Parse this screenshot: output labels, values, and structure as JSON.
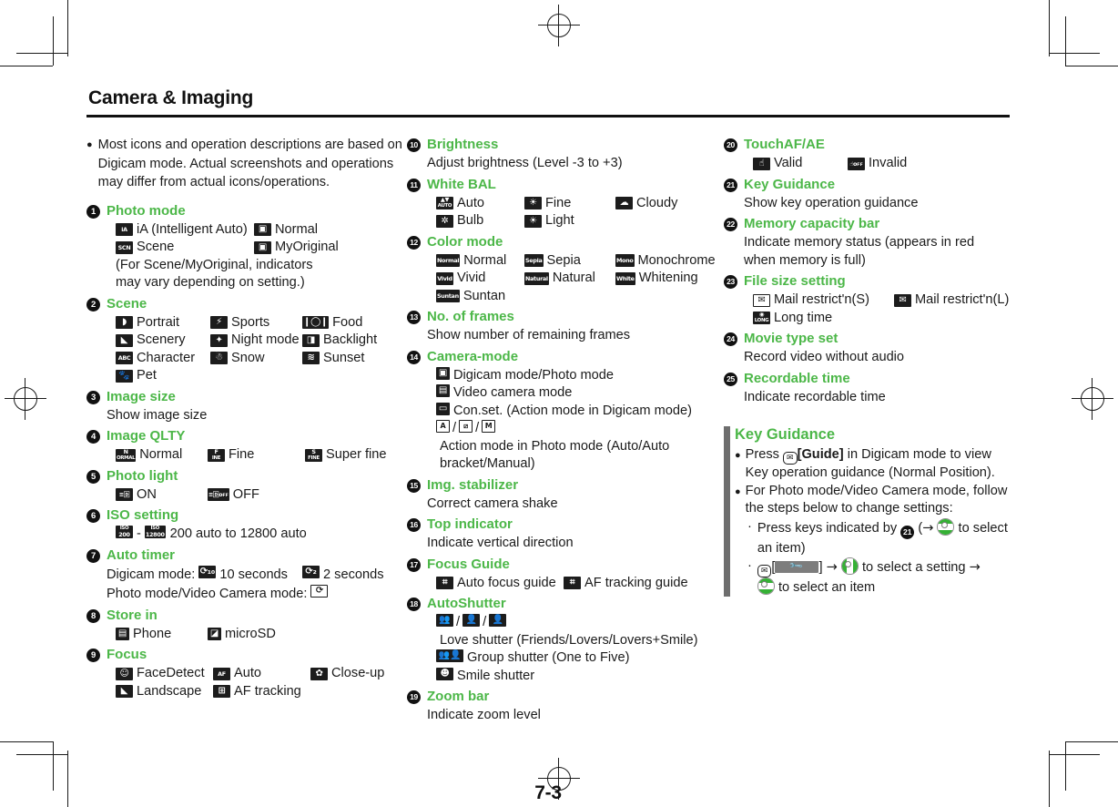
{
  "document": {
    "chapter_title": "Camera & Imaging",
    "page_number": "7-3"
  },
  "intro_note": "Most icons and operation descriptions are based on Digicam mode. Actual screenshots and operations may differ from actual icons/operations.",
  "column1": {
    "entries": [
      {
        "num": "1",
        "title": "Photo mode",
        "rows": [
          [
            {
              "icon": "iA",
              "label": "iA (Intelligent Auto)"
            },
            {
              "icon": "camera",
              "label": "Normal"
            }
          ],
          [
            {
              "icon": "SCN",
              "label": "Scene"
            },
            {
              "icon": "my-camera",
              "label": "MyOriginal"
            }
          ]
        ],
        "note": "(For Scene/MyOriginal, indicators may vary depending on setting.)"
      },
      {
        "num": "2",
        "title": "Scene",
        "rows": [
          [
            {
              "icon": "portrait",
              "label": "Portrait"
            },
            {
              "icon": "sports",
              "label": "Sports"
            },
            {
              "icon": "food",
              "label": "Food"
            }
          ],
          [
            {
              "icon": "scenery",
              "label": "Scenery"
            },
            {
              "icon": "night",
              "label": "Night mode"
            },
            {
              "icon": "backlight",
              "label": "Backlight"
            }
          ],
          [
            {
              "icon": "ABC",
              "label": "Character"
            },
            {
              "icon": "snow",
              "label": "Snow"
            },
            {
              "icon": "sunset",
              "label": "Sunset"
            }
          ],
          [
            {
              "icon": "pet",
              "label": "Pet"
            }
          ]
        ]
      },
      {
        "num": "3",
        "title": "Image size",
        "desc": "Show image size"
      },
      {
        "num": "4",
        "title": "Image QLTY",
        "rows": [
          [
            {
              "icon": "N-ORMAL",
              "label": "Normal"
            },
            {
              "icon": "F-INE",
              "label": "Fine"
            },
            {
              "icon": "S-FINE",
              "label": "Super fine"
            }
          ]
        ]
      },
      {
        "num": "5",
        "title": "Photo light",
        "rows": [
          [
            {
              "icon": "light-on",
              "label": "ON"
            },
            {
              "icon": "light-off",
              "label": "OFF"
            }
          ]
        ]
      },
      {
        "num": "6",
        "title": "ISO setting",
        "iso_line": {
          "icon_low": "ISO 200",
          "dash": "-",
          "icon_high": "ISO 12800",
          "label": "200 auto to 12800 auto"
        }
      },
      {
        "num": "7",
        "title": "Auto timer",
        "timer_line1_prefix": "Digicam mode:",
        "timer_10": "10 seconds",
        "timer_2": "2 seconds",
        "timer_line2_prefix": "Photo mode/Video Camera mode:"
      },
      {
        "num": "8",
        "title": "Store in",
        "rows": [
          [
            {
              "icon": "phone",
              "label": "Phone"
            },
            {
              "icon": "microsd",
              "label": "microSD"
            }
          ]
        ]
      },
      {
        "num": "9",
        "title": "Focus",
        "rows": [
          [
            {
              "icon": "facedetect",
              "label": "FaceDetect"
            },
            {
              "icon": "AF",
              "label": "Auto"
            },
            {
              "icon": "closeup",
              "label": "Close-up"
            }
          ],
          [
            {
              "icon": "landscape",
              "label": "Landscape"
            },
            {
              "icon": "af-tracking",
              "label": "AF tracking"
            }
          ]
        ]
      }
    ]
  },
  "column2": {
    "entries": [
      {
        "num": "10",
        "title": "Brightness",
        "desc": "Adjust brightness (Level -3 to +3)"
      },
      {
        "num": "11",
        "title": "White BAL",
        "rows": [
          [
            {
              "icon": "wb-auto",
              "label": "Auto"
            },
            {
              "icon": "wb-fine",
              "label": "Fine"
            },
            {
              "icon": "wb-cloudy",
              "label": "Cloudy"
            }
          ],
          [
            {
              "icon": "wb-bulb",
              "label": "Bulb"
            },
            {
              "icon": "wb-light",
              "label": "Light"
            }
          ]
        ]
      },
      {
        "num": "12",
        "title": "Color mode",
        "rows": [
          [
            {
              "icon": "Normal",
              "label": "Normal"
            },
            {
              "icon": "Sepia",
              "label": "Sepia"
            },
            {
              "icon": "Mono",
              "label": "Monochrome"
            }
          ],
          [
            {
              "icon": "Vivid",
              "label": "Vivid"
            },
            {
              "icon": "Natural",
              "label": "Natural"
            },
            {
              "icon": "White",
              "label": "Whitening"
            }
          ],
          [
            {
              "icon": "Suntan",
              "label": "Suntan"
            }
          ]
        ]
      },
      {
        "num": "13",
        "title": "No. of frames",
        "desc": "Show number of remaining frames"
      },
      {
        "num": "14",
        "title": "Camera-mode",
        "mode_lines": [
          {
            "icons": [
              "cam-digicam"
            ],
            "label": "Digicam mode/Photo mode"
          },
          {
            "icons": [
              "cam-video"
            ],
            "label": "Video camera mode"
          },
          {
            "icons": [
              "cam-conset"
            ],
            "label": "Con.set. (Action mode in Digicam mode)"
          },
          {
            "icons": [
              "act-A",
              "act-bracket",
              "act-M"
            ],
            "label": "Action mode in Photo mode (Auto/Auto bracket/Manual)"
          }
        ]
      },
      {
        "num": "15",
        "title": "Img. stabilizer",
        "desc": "Correct camera shake"
      },
      {
        "num": "16",
        "title": "Top indicator",
        "desc": "Indicate vertical direction"
      },
      {
        "num": "17",
        "title": "Focus Guide",
        "rows": [
          [
            {
              "icon": "focus-guide",
              "label": "Auto focus guide"
            },
            {
              "icon": "af-track-guide",
              "label": "AF tracking guide"
            }
          ]
        ]
      },
      {
        "num": "18",
        "title": "AutoShutter",
        "shutter_lines": [
          {
            "icons": [
              "love-friends",
              "love-lovers",
              "love-smile"
            ],
            "label": "Love shutter (Friends/Lovers/Lovers+Smile)"
          },
          {
            "icons": [
              "group-shutter"
            ],
            "label": "Group shutter (One to Five)"
          },
          {
            "icons": [
              "smile-shutter"
            ],
            "label": "Smile shutter"
          }
        ]
      },
      {
        "num": "19",
        "title": "Zoom bar",
        "desc": "Indicate zoom level"
      }
    ]
  },
  "column3": {
    "entries": [
      {
        "num": "20",
        "title": "TouchAF/AE",
        "rows": [
          [
            {
              "icon": "touch-valid",
              "label": "Valid"
            },
            {
              "icon": "touch-invalid",
              "label": "Invalid"
            }
          ]
        ]
      },
      {
        "num": "21",
        "title": "Key Guidance",
        "desc": "Show key operation guidance"
      },
      {
        "num": "22",
        "title": "Memory capacity bar",
        "desc": "Indicate memory status (appears in red when memory is full)"
      },
      {
        "num": "23",
        "title": "File size setting",
        "rows": [
          [
            {
              "icon": "mail-s",
              "label": "Mail restrict'n(S)"
            },
            {
              "icon": "mail-l",
              "label": "Mail restrict'n(L)"
            }
          ],
          [
            {
              "icon": "long-time",
              "label": "Long time"
            }
          ]
        ]
      },
      {
        "num": "24",
        "title": "Movie type set",
        "desc": "Record video without audio"
      },
      {
        "num": "25",
        "title": "Recordable time",
        "desc": "Indicate recordable time"
      }
    ],
    "key_guidance": {
      "title": "Key Guidance",
      "bullet1": {
        "prefix": "Press",
        "bracket": "[Guide]",
        "rest": "in Digicam mode to view Key operation guidance (Normal Position)."
      },
      "bullet2": {
        "text": "For Photo mode/Video Camera mode, follow the steps below to change settings:",
        "sub1": {
          "prefix": "Press keys indicated by",
          "badge": "21",
          "open_paren": "(",
          "arrow": "→",
          "suffix": "to select an item)"
        },
        "sub2": {
          "bracket_open": "[",
          "bracket_close": "]",
          "arrow1": "→",
          "mid": "to select a setting",
          "arrow2": "→",
          "tail": "to select an item"
        }
      }
    }
  },
  "colors": {
    "heading_green": "#4cb748",
    "icon_black": "#1c1c1c",
    "key_bar_gray": "#6e6e6e",
    "nav_key_green": "#35b035"
  }
}
